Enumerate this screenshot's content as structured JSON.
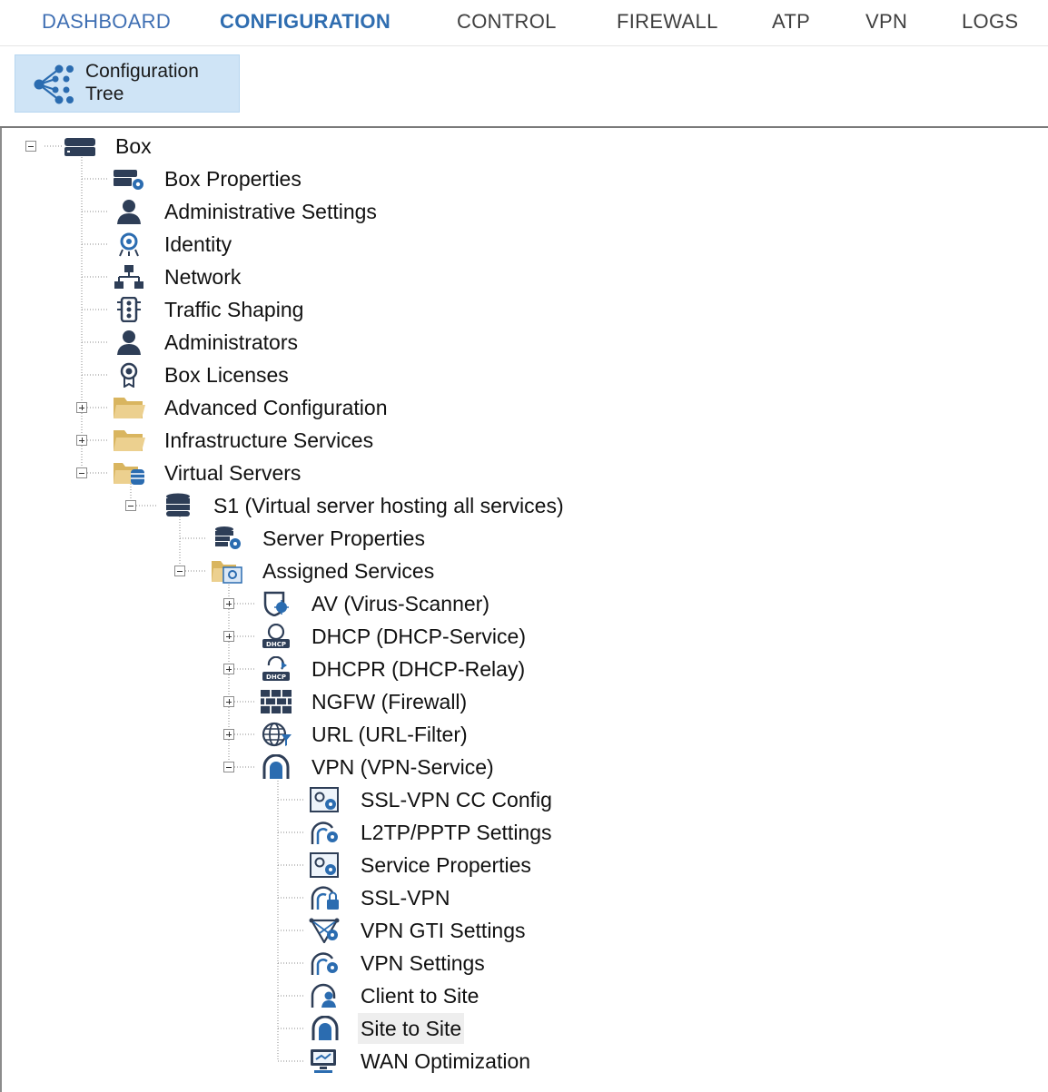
{
  "top_menu": {
    "tabs": [
      "DASHBOARD",
      "CONFIGURATION",
      "CONTROL",
      "FIREWALL",
      "ATP",
      "VPN",
      "LOGS"
    ],
    "active": "CONFIGURATION"
  },
  "ribbon": {
    "button_line1": "Configuration",
    "button_line2": "Tree"
  },
  "tree": {
    "box": "Box",
    "box_properties": "Box Properties",
    "administrative_settings": "Administrative Settings",
    "identity": "Identity",
    "network": "Network",
    "traffic_shaping": "Traffic Shaping",
    "administrators": "Administrators",
    "box_licenses": "Box Licenses",
    "advanced_configuration": "Advanced Configuration",
    "infrastructure_services": "Infrastructure Services",
    "virtual_servers": "Virtual Servers",
    "s1": "S1 (Virtual server hosting all services)",
    "server_properties": "Server Properties",
    "assigned_services": "Assigned Services",
    "av": "AV (Virus-Scanner)",
    "dhcp": "DHCP (DHCP-Service)",
    "dhcpr": "DHCPR (DHCP-Relay)",
    "ngfw": "NGFW (Firewall)",
    "url": "URL (URL-Filter)",
    "vpn": "VPN (VPN-Service)",
    "ssl_vpn_cc_config": "SSL-VPN CC Config",
    "l2tp_pptp_settings": "L2TP/PPTP Settings",
    "service_properties": "Service Properties",
    "ssl_vpn": "SSL-VPN",
    "vpn_gti_settings": "VPN GTI Settings",
    "vpn_settings": "VPN Settings",
    "client_to_site": "Client to Site",
    "site_to_site": "Site to Site",
    "wan_optimization": "WAN Optimization",
    "selected": "Site to Site"
  },
  "colors": {
    "accent": "#2f6db0",
    "icon_blue": "#2b6cb0",
    "icon_dark": "#2e3e57",
    "folder": "#e3c27a",
    "ribbon_bg": "#cfe4f6",
    "selected_bg": "#eeeeee"
  }
}
